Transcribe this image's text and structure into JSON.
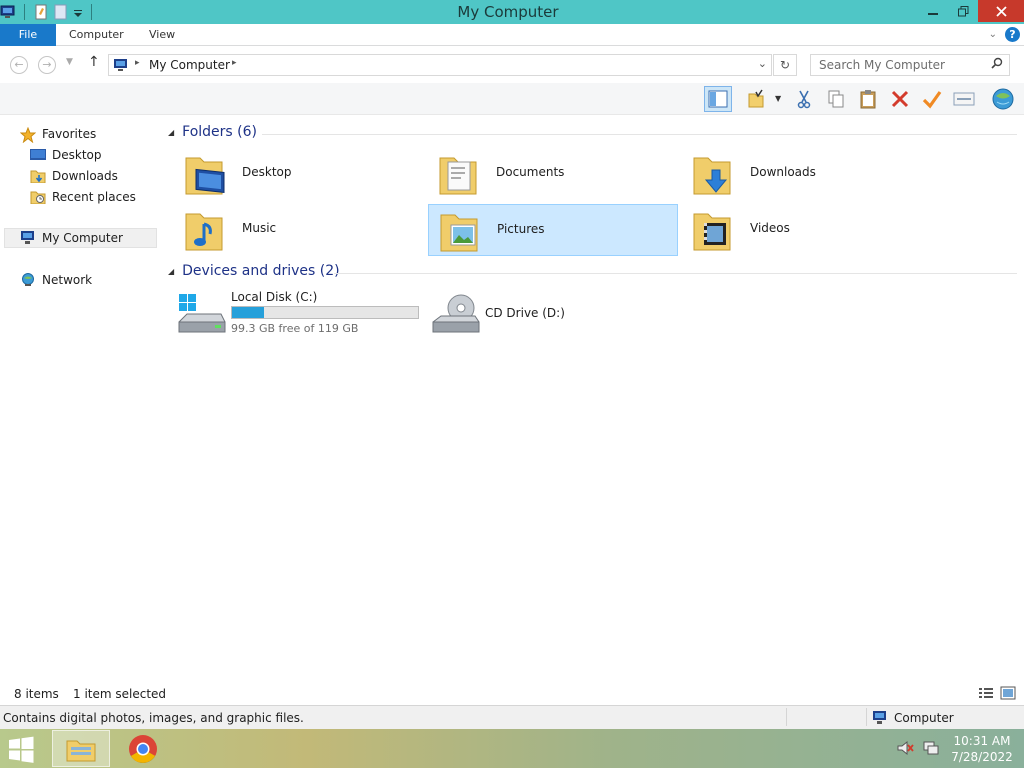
{
  "window": {
    "title": "My Computer"
  },
  "menu": {
    "file": "File",
    "computer": "Computer",
    "view": "View"
  },
  "address": {
    "path": "My Computer",
    "search_placeholder": "Search My Computer"
  },
  "sidebar": {
    "favorites": "Favorites",
    "favorite_items": [
      "Desktop",
      "Downloads",
      "Recent places"
    ],
    "my_computer": "My Computer",
    "network": "Network"
  },
  "content": {
    "folders_header": "Folders (6)",
    "folders": [
      "Desktop",
      "Documents",
      "Downloads",
      "Music",
      "Pictures",
      "Videos"
    ],
    "selected_folder": "Pictures",
    "drives_header": "Devices and drives (2)",
    "drives": [
      {
        "name": "Local Disk (C:)",
        "free": "99.3 GB free of 119 GB",
        "used_fraction": 0.17
      },
      {
        "name": "CD Drive (D:)"
      }
    ]
  },
  "status": {
    "items": "8 items",
    "selected": "1 item selected"
  },
  "info": {
    "description": "Contains digital photos, images, and graphic files.",
    "zone": "Computer"
  },
  "taskbar": {
    "time": "10:31 AM",
    "date": "7/28/2022"
  },
  "colors": {
    "titlebar": "#4fc6c6",
    "accent": "#1979ca",
    "selection": "#cce8ff",
    "close": "#c7392b"
  }
}
